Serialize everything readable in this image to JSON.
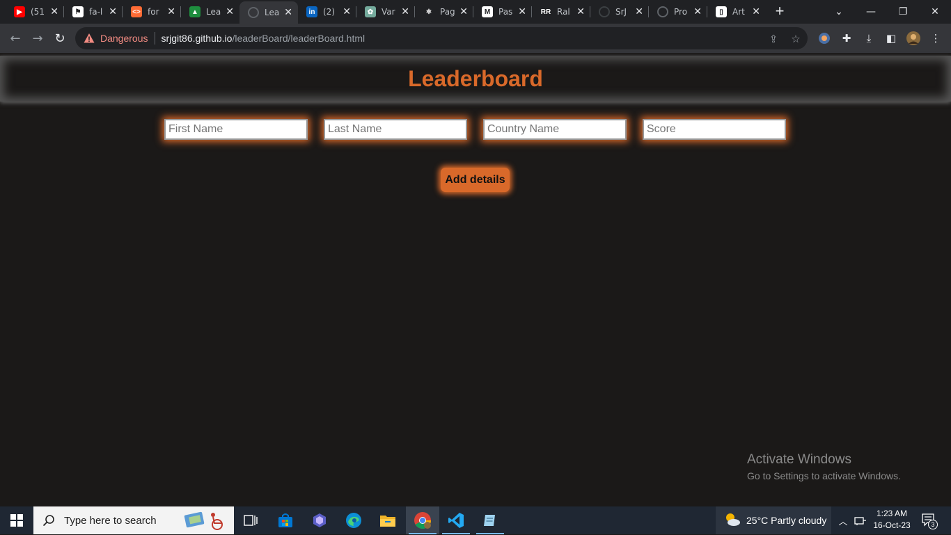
{
  "browser": {
    "tabs": [
      {
        "title": "(51",
        "icon": "youtube-icon",
        "color": "#ff0000",
        "glyph": "▶"
      },
      {
        "title": "fa-l",
        "icon": "flag-icon",
        "color": "#ffffff",
        "glyph": "⚑"
      },
      {
        "title": "for",
        "icon": "code-icon",
        "color": "#ff6b35",
        "glyph": "<>"
      },
      {
        "title": "Lea",
        "icon": "classroom-icon",
        "color": "#1e8e3e",
        "glyph": "▲"
      },
      {
        "title": "Lea",
        "icon": "globe-icon",
        "color": "#5f6368",
        "glyph": "◌",
        "active": true
      },
      {
        "title": "(2)",
        "icon": "linkedin-icon",
        "color": "#0a66c2",
        "glyph": "in"
      },
      {
        "title": "Var",
        "icon": "chatgpt-icon",
        "color": "#74aa9c",
        "glyph": "✿"
      },
      {
        "title": "Pag",
        "icon": "react-icon",
        "color": "#202124",
        "glyph": "⚛"
      },
      {
        "title": "Pas",
        "icon": "gmail-icon",
        "color": "#ffffff",
        "glyph": "M"
      },
      {
        "title": "Ral",
        "icon": "app-icon",
        "color": "#202124",
        "glyph": "RR"
      },
      {
        "title": "SrJ",
        "icon": "github-icon",
        "color": "#202124",
        "glyph": "●"
      },
      {
        "title": "Pro",
        "icon": "globe-icon",
        "color": "#5f6368",
        "glyph": "◌"
      },
      {
        "title": "Art",
        "icon": "document-icon",
        "color": "#ffffff",
        "glyph": "▯"
      }
    ],
    "security_label": "Dangerous",
    "url_host": "srjgit86.github.io",
    "url_path": "/leaderBoard/leaderBoard.html"
  },
  "page": {
    "title": "Leaderboard",
    "fields": [
      {
        "placeholder": "First Name"
      },
      {
        "placeholder": "Last Name"
      },
      {
        "placeholder": "Country Name"
      },
      {
        "placeholder": "Score"
      }
    ],
    "add_button": "Add details",
    "accent_color": "#d9692a"
  },
  "watermark": {
    "line1": "Activate Windows",
    "line2": "Go to Settings to activate Windows."
  },
  "taskbar": {
    "search_placeholder": "Type here to search",
    "weather": "25°C  Partly cloudy",
    "time": "1:23 AM",
    "date": "16-Oct-23",
    "notification_count": "3"
  }
}
